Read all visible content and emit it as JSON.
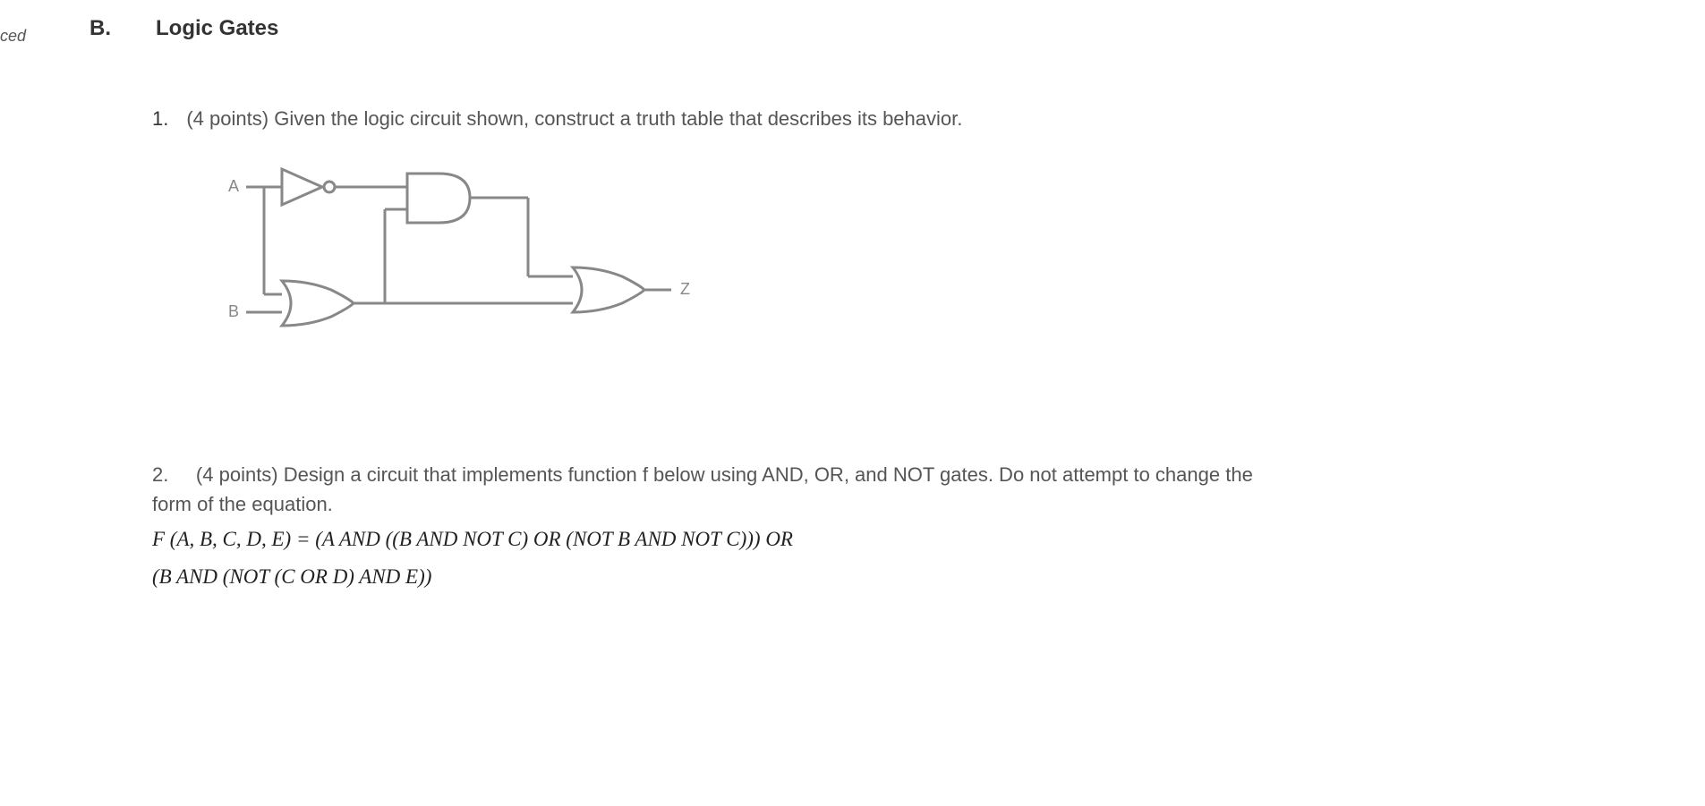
{
  "sideText": "ced",
  "section": {
    "letter": "B.",
    "title": "Logic Gates"
  },
  "questions": [
    {
      "number": "1.",
      "points": "(4 points)",
      "text": "Given the logic circuit shown, construct a truth table that describes its behavior.",
      "circuit": {
        "inputA": "A",
        "inputB": "B",
        "outputZ": "Z"
      }
    },
    {
      "number": "2.",
      "points": "(4 points)",
      "text": "Design a circuit that implements function f below using AND, OR, and NOT gates. Do not attempt to change the form of the equation.",
      "formulaLine1": "F (A, B, C, D, E) = (A AND ((B AND NOT C) OR (NOT B AND NOT C))) OR",
      "formulaLine2": " (B AND (NOT (C OR D) AND E))"
    }
  ]
}
